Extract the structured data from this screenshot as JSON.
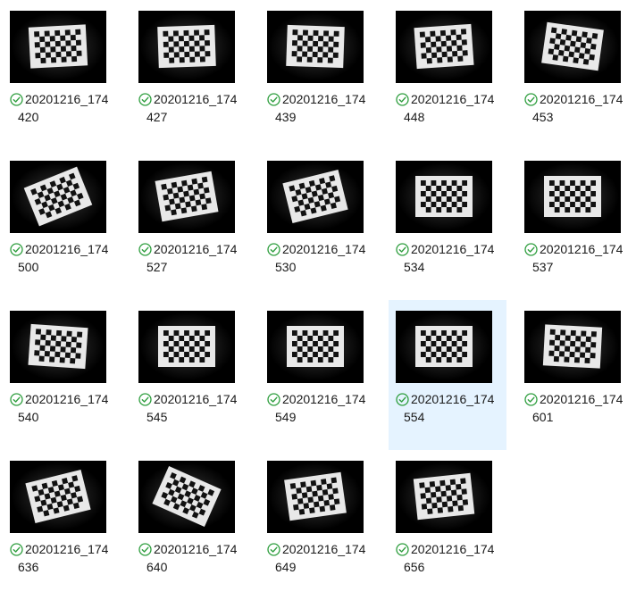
{
  "files": [
    {
      "line1": "20201216_174",
      "line2": "420",
      "sync_status": "synced-check-icon",
      "selected": false,
      "rot": -3
    },
    {
      "line1": "20201216_174",
      "line2": "427",
      "sync_status": "synced-check-icon",
      "selected": false,
      "rot": -2
    },
    {
      "line1": "20201216_174",
      "line2": "439",
      "sync_status": "synced-check-icon",
      "selected": false,
      "rot": 2
    },
    {
      "line1": "20201216_174",
      "line2": "448",
      "sync_status": "synced-check-icon",
      "selected": false,
      "rot": -4
    },
    {
      "line1": "20201216_174",
      "line2": "453",
      "sync_status": "synced-check-icon",
      "selected": false,
      "rot": 8
    },
    {
      "line1": "20201216_174",
      "line2": "500",
      "sync_status": "synced-check-icon",
      "selected": false,
      "rot": -22
    },
    {
      "line1": "20201216_174",
      "line2": "527",
      "sync_status": "synced-check-icon",
      "selected": false,
      "rot": -10
    },
    {
      "line1": "20201216_174",
      "line2": "530",
      "sync_status": "synced-check-icon",
      "selected": false,
      "rot": -14
    },
    {
      "line1": "20201216_174",
      "line2": "534",
      "sync_status": "synced-check-icon",
      "selected": false,
      "rot": 0
    },
    {
      "line1": "20201216_174",
      "line2": "537",
      "sync_status": "synced-check-icon",
      "selected": false,
      "rot": 0
    },
    {
      "line1": "20201216_174",
      "line2": "540",
      "sync_status": "synced-check-icon",
      "selected": false,
      "rot": 4
    },
    {
      "line1": "20201216_174",
      "line2": "545",
      "sync_status": "synced-check-icon",
      "selected": false,
      "rot": 0
    },
    {
      "line1": "20201216_174",
      "line2": "549",
      "sync_status": "synced-check-icon",
      "selected": false,
      "rot": 0
    },
    {
      "line1": "20201216_174",
      "line2": "554",
      "sync_status": "synced-check-icon",
      "selected": true,
      "rot": 0
    },
    {
      "line1": "20201216_174",
      "line2": "601",
      "sync_status": "synced-check-icon",
      "selected": false,
      "rot": 3
    },
    {
      "line1": "20201216_174",
      "line2": "636",
      "sync_status": "synced-check-icon",
      "selected": false,
      "rot": -14
    },
    {
      "line1": "20201216_174",
      "line2": "640",
      "sync_status": "synced-check-icon",
      "selected": false,
      "rot": 24
    },
    {
      "line1": "20201216_174",
      "line2": "649",
      "sync_status": "synced-check-icon",
      "selected": false,
      "rot": -8
    },
    {
      "line1": "20201216_174",
      "line2": "656",
      "sync_status": "synced-check-icon",
      "selected": false,
      "rot": -6
    }
  ],
  "colors": {
    "selection_bg": "#e5f3ff",
    "sync_check": "#2e9e3e",
    "text": "#1a1a1a"
  }
}
